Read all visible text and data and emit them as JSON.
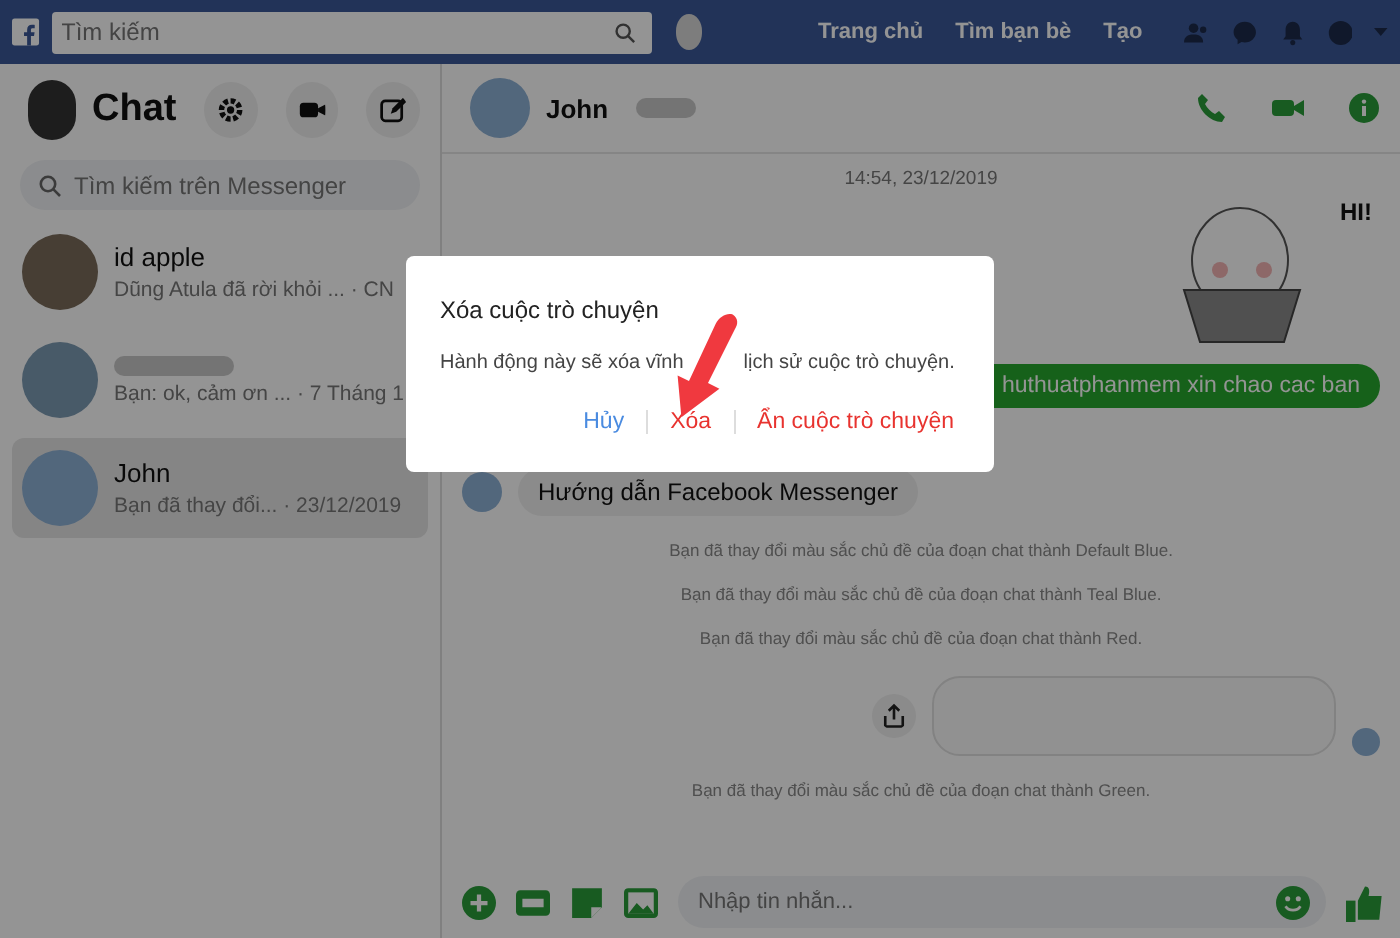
{
  "topbar": {
    "search_placeholder": "Tìm kiếm",
    "nav": [
      "Trang chủ",
      "Tìm bạn bè",
      "Tạo"
    ]
  },
  "sidebar": {
    "title": "Chat",
    "search_placeholder": "Tìm kiếm trên Messenger",
    "conversations": [
      {
        "name": "id apple",
        "preview": "Dũng Atula đã rời khỏi ...",
        "time": "· CN",
        "selected": false
      },
      {
        "preview": "Bạn: ok, cảm ơn ...",
        "time": "· 7 Tháng 1",
        "selected": false
      },
      {
        "name": "John",
        "preview": "Bạn đã thay đổi...",
        "time": "· 23/12/2019",
        "selected": true
      }
    ]
  },
  "chat": {
    "name": "John",
    "timestamp": "14:54, 23/12/2019",
    "sticker_caption": "HI!",
    "sent_message": "huthuatphanmem xin chao cac ban",
    "received_message": "Hướng dẫn Facebook Messenger",
    "notices": [
      "Bạn đã thay đổi màu sắc chủ đề của đoạn chat thành Default Blue.",
      "Bạn đã thay đổi màu sắc chủ đề của đoạn chat thành Teal Blue.",
      "Bạn đã thay đổi màu sắc chủ đề của đoạn chat thành Red."
    ],
    "last_notice": "Bạn đã thay đổi màu sắc chủ đề của đoạn chat thành Green.",
    "composer_placeholder": "Nhập tin nhắn..."
  },
  "dialog": {
    "title": "Xóa cuộc trò chuyện",
    "body_parts": [
      "Hành động này sẽ xóa vĩnh",
      "lịch sử cuộc trò chuyện."
    ],
    "buttons": [
      {
        "label": "Hủy",
        "kind": "cancel"
      },
      {
        "label": "Xóa",
        "kind": "danger"
      },
      {
        "label": "Ẩn cuộc trò chuyện",
        "kind": "danger"
      }
    ]
  }
}
